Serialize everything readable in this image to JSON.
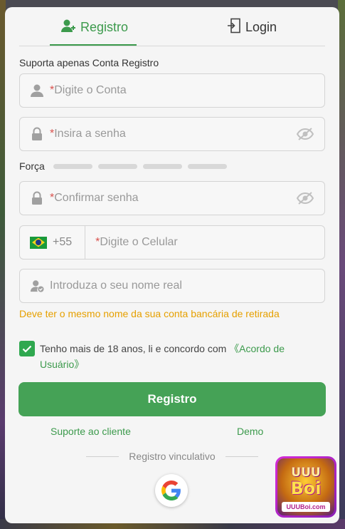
{
  "tabs": {
    "register": "Registro",
    "login": "Login"
  },
  "note": "Suporta apenas Conta Registro",
  "fields": {
    "account": {
      "required": "*",
      "placeholder": "Digite o Conta"
    },
    "password": {
      "required": "*",
      "placeholder": "Insira a senha"
    },
    "confirm": {
      "required": "*",
      "placeholder": "Confirmar senha"
    },
    "phone": {
      "prefix": "+55",
      "required": "*",
      "placeholder": "Digite o Celular"
    },
    "realname": {
      "placeholder": "Introduza o seu nome real"
    }
  },
  "strength": {
    "label": "Força"
  },
  "warning": "Deve ter o mesmo nome da sua conta bancária de retirada",
  "agreement": {
    "checked": true,
    "text": "Tenho mais de 18 anos, li e concordo com ",
    "link": "《Acordo de Usuário》"
  },
  "submit_label": "Registro",
  "links": {
    "support": "Suporte ao cliente",
    "demo": "Demo"
  },
  "separator": "Registro vinculativo",
  "logo": {
    "top": "UUU",
    "mid": "Boi",
    "foot": "UUUBoi.com"
  },
  "colors": {
    "accent": "#45a256",
    "warning": "#e6a000",
    "required": "#d9534f"
  }
}
